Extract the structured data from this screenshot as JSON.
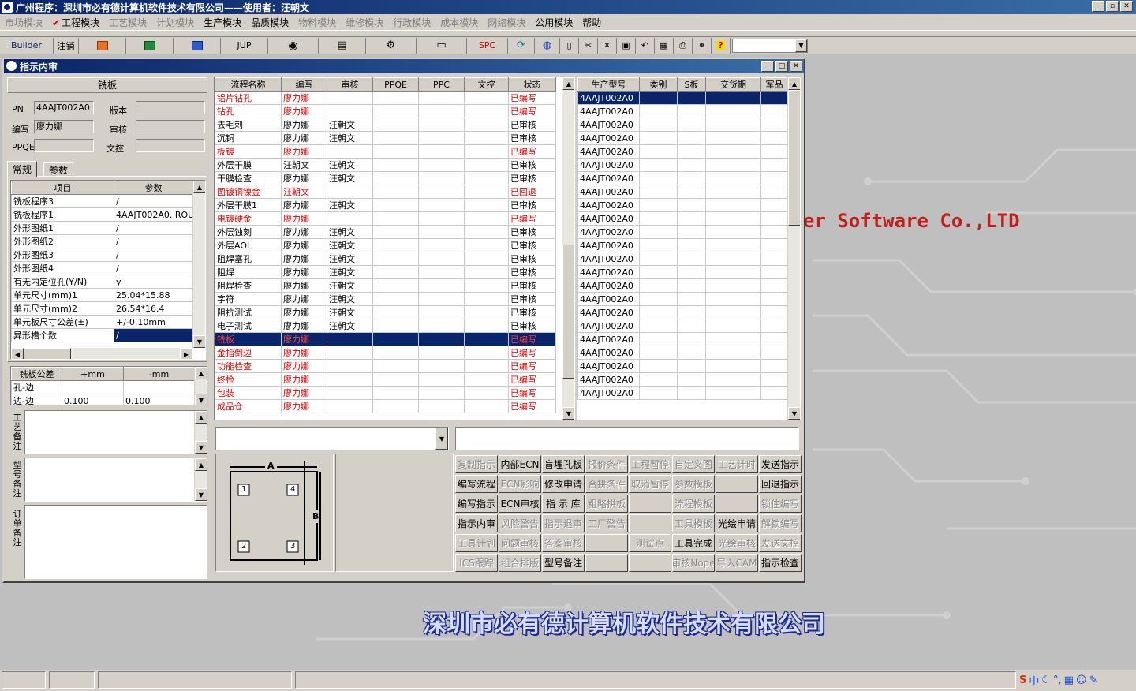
{
  "window": {
    "title": "广州程序：深圳市必有德计算机软件技术有限公司——使用者：汪朝文"
  },
  "menu": [
    {
      "label": "市场模块",
      "enabled": false
    },
    {
      "label": "工程模块",
      "enabled": true,
      "checked": true
    },
    {
      "label": "工艺模块",
      "enabled": false
    },
    {
      "label": "计划模块",
      "enabled": false
    },
    {
      "label": "生产模块",
      "enabled": true
    },
    {
      "label": "品质模块",
      "enabled": true
    },
    {
      "label": "物料模块",
      "enabled": false
    },
    {
      "label": "维修模块",
      "enabled": false
    },
    {
      "label": "行政模块",
      "enabled": false
    },
    {
      "label": "成本模块",
      "enabled": false
    },
    {
      "label": "网络模块",
      "enabled": false
    },
    {
      "label": "公用模块",
      "enabled": true
    },
    {
      "label": "帮助",
      "enabled": true
    }
  ],
  "toolbar": {
    "builder": "Builder",
    "logout": "注销",
    "jup": "JUP",
    "spc": "SPC"
  },
  "watermark": {
    "en": "er Software Co.,LTD",
    "cn": "深圳市必有德计算机软件技术有限公司"
  },
  "child": {
    "title": "指示内审"
  },
  "left": {
    "header": "铣板",
    "pn_label": "PN",
    "pn_value": "4AAJT002A0",
    "version_label": "版本",
    "version_value": "",
    "writer_label": "编写",
    "writer_value": "廖力娜",
    "review_label": "审核",
    "review_value": "",
    "ppqe_label": "PPQE",
    "ppqe_value": "",
    "doc_label": "文控",
    "doc_value": "",
    "tabs": [
      "常规",
      "参数"
    ],
    "param_headers": [
      "项目",
      "参数"
    ],
    "params": [
      [
        "铣板程序3",
        "/"
      ],
      [
        "铣板程序1",
        "4AAJT002A0. ROU"
      ],
      [
        "外形图纸1",
        "/"
      ],
      [
        "外形图纸2",
        "/"
      ],
      [
        "外形图纸3",
        "/"
      ],
      [
        "外形图纸4",
        "/"
      ],
      [
        "有无内定位孔(Y/N)",
        "y"
      ],
      [
        "单元尺寸(mm)1",
        "25.04*15.88"
      ],
      [
        "单元尺寸(mm)2",
        "26.54*16.4"
      ],
      [
        "单元板尺寸公差(±)",
        "+/-0.10mm"
      ],
      [
        "异形槽个数",
        "/"
      ]
    ],
    "tol_headers": [
      "铣板公差",
      "+mm",
      "-mm"
    ],
    "tol_rows": [
      [
        "孔-边",
        "",
        ""
      ],
      [
        "边-边",
        "0.100",
        "0.100"
      ]
    ],
    "remark1": "工艺备注",
    "remark2": "型号备注",
    "remark3": "订单备注"
  },
  "process": {
    "headers": [
      "流程名称",
      "编写",
      "审核",
      "PPQE",
      "PPC",
      "文控",
      "状态"
    ],
    "rows": [
      {
        "name": "铝片钻孔",
        "writer": "廖力娜",
        "reviewer": "",
        "status": "已编写",
        "red": true
      },
      {
        "name": "钻孔",
        "writer": "廖力娜",
        "reviewer": "",
        "status": "已编写",
        "red": true
      },
      {
        "name": "去毛刺",
        "writer": "廖力娜",
        "reviewer": "汪朝文",
        "status": "已审核",
        "red": false
      },
      {
        "name": "沉铜",
        "writer": "廖力娜",
        "reviewer": "汪朝文",
        "status": "已审核",
        "red": false
      },
      {
        "name": "板镀",
        "writer": "廖力娜",
        "reviewer": "",
        "status": "已编写",
        "red": true
      },
      {
        "name": "外层干膜",
        "writer": "汪朝文",
        "reviewer": "汪朝文",
        "status": "已审核",
        "red": false
      },
      {
        "name": "干膜检查",
        "writer": "廖力娜",
        "reviewer": "汪朝文",
        "status": "已审核",
        "red": false
      },
      {
        "name": "图镀铜镍金",
        "writer": "汪朝文",
        "reviewer": "",
        "status": "已回退",
        "red": true
      },
      {
        "name": "外层干膜1",
        "writer": "廖力娜",
        "reviewer": "汪朝文",
        "status": "已审核",
        "red": false
      },
      {
        "name": "电镀硬金",
        "writer": "廖力娜",
        "reviewer": "",
        "status": "已编写",
        "red": true
      },
      {
        "name": "外层蚀刻",
        "writer": "廖力娜",
        "reviewer": "汪朝文",
        "status": "已审核",
        "red": false
      },
      {
        "name": "外层AOI",
        "writer": "廖力娜",
        "reviewer": "汪朝文",
        "status": "已审核",
        "red": false
      },
      {
        "name": "阻焊塞孔",
        "writer": "廖力娜",
        "reviewer": "汪朝文",
        "status": "已审核",
        "red": false
      },
      {
        "name": "阻焊",
        "writer": "廖力娜",
        "reviewer": "汪朝文",
        "status": "已审核",
        "red": false
      },
      {
        "name": "阻焊检查",
        "writer": "廖力娜",
        "reviewer": "汪朝文",
        "status": "已审核",
        "red": false
      },
      {
        "name": "字符",
        "writer": "廖力娜",
        "reviewer": "汪朝文",
        "status": "已审核",
        "red": false
      },
      {
        "name": "阻抗测试",
        "writer": "廖力娜",
        "reviewer": "汪朝文",
        "status": "已审核",
        "red": false
      },
      {
        "name": "电子测试",
        "writer": "廖力娜",
        "reviewer": "汪朝文",
        "status": "已审核",
        "red": false
      },
      {
        "name": "铣板",
        "writer": "廖力娜",
        "reviewer": "",
        "status": "已编写",
        "red": true,
        "selected": true
      },
      {
        "name": "金指倒边",
        "writer": "廖力娜",
        "reviewer": "",
        "status": "已编写",
        "red": true
      },
      {
        "name": "功能检查",
        "writer": "廖力娜",
        "reviewer": "",
        "status": "已编写",
        "red": true
      },
      {
        "name": "终检",
        "writer": "廖力娜",
        "reviewer": "",
        "status": "已编写",
        "red": true
      },
      {
        "name": "包装",
        "writer": "廖力娜",
        "reviewer": "",
        "status": "已编写",
        "red": true
      },
      {
        "name": "成品仓",
        "writer": "廖力娜",
        "reviewer": "",
        "status": "已编写",
        "red": true
      }
    ]
  },
  "models": {
    "headers": [
      "生产型号",
      "类别",
      "S板",
      "交货期",
      "军品"
    ],
    "rows": [
      "4AAJT002A0",
      "4AAJT002A0",
      "4AAJT002A0",
      "4AAJT002A0",
      "4AAJT002A0",
      "4AAJT002A0",
      "4AAJT002A0",
      "4AAJT002A0",
      "4AAJT002A0",
      "4AAJT002A0",
      "4AAJT002A0",
      "4AAJT002A0",
      "4AAJT002A0",
      "4AAJT002A0",
      "4AAJT002A0",
      "4AAJT002A0",
      "4AAJT002A0",
      "4AAJT002A0",
      "4AAJT002A0",
      "4AAJT002A0",
      "4AAJT002A0",
      "4AAJT002A0",
      "4AAJT002A0"
    ]
  },
  "diagram": {
    "a": "A",
    "b": "B",
    "n1": "1",
    "n2": "2",
    "n3": "3",
    "n4": "4"
  },
  "buttons": [
    [
      {
        "t": "复制指示",
        "e": false
      },
      {
        "t": "内部ECN",
        "e": true
      },
      {
        "t": "盲埋孔板",
        "e": true
      },
      {
        "t": "报价条件",
        "e": false
      },
      {
        "t": "工程暂停",
        "e": false
      },
      {
        "t": "自定义图",
        "e": false
      },
      {
        "t": "工艺计时",
        "e": false
      },
      {
        "t": "发送指示",
        "e": true
      }
    ],
    [
      {
        "t": "编写流程",
        "e": true
      },
      {
        "t": "ECN影响",
        "e": false
      },
      {
        "t": "修改申请",
        "e": true
      },
      {
        "t": "合拼条件",
        "e": false
      },
      {
        "t": "取消暂停",
        "e": false
      },
      {
        "t": "参数模板",
        "e": false
      },
      {
        "t": "",
        "e": false
      },
      {
        "t": "回退指示",
        "e": true
      }
    ],
    [
      {
        "t": "编写指示",
        "e": true
      },
      {
        "t": "ECN审核",
        "e": true
      },
      {
        "t": "指 示 库",
        "e": true
      },
      {
        "t": "粗略拼板",
        "e": false
      },
      {
        "t": "",
        "e": false
      },
      {
        "t": "流程模板",
        "e": false
      },
      {
        "t": "",
        "e": false
      },
      {
        "t": "锁住编写",
        "e": false
      }
    ],
    [
      {
        "t": "指示内审",
        "e": true
      },
      {
        "t": "风险警告",
        "e": false
      },
      {
        "t": "指示退审",
        "e": false
      },
      {
        "t": "工厂警告",
        "e": false
      },
      {
        "t": "",
        "e": false
      },
      {
        "t": "工具模板",
        "e": false
      },
      {
        "t": "光绘申请",
        "e": true
      },
      {
        "t": "解锁编写",
        "e": false
      }
    ],
    [
      {
        "t": "工具计划",
        "e": false
      },
      {
        "t": "问题审核",
        "e": false
      },
      {
        "t": "答案审核",
        "e": false
      },
      {
        "t": "",
        "e": false
      },
      {
        "t": "测试点",
        "e": false
      },
      {
        "t": "工具完成",
        "e": true
      },
      {
        "t": "光绘审核",
        "e": false
      },
      {
        "t": "发送文控",
        "e": false
      }
    ],
    [
      {
        "t": "ICS跟踪",
        "e": false
      },
      {
        "t": "组合排版",
        "e": false
      },
      {
        "t": "型号备注",
        "e": true
      },
      {
        "t": "",
        "e": false
      },
      {
        "t": "",
        "e": false
      },
      {
        "t": "审核Nope",
        "e": false
      },
      {
        "t": "导入CAM",
        "e": false
      },
      {
        "t": "指示检查",
        "e": true
      }
    ]
  ]
}
